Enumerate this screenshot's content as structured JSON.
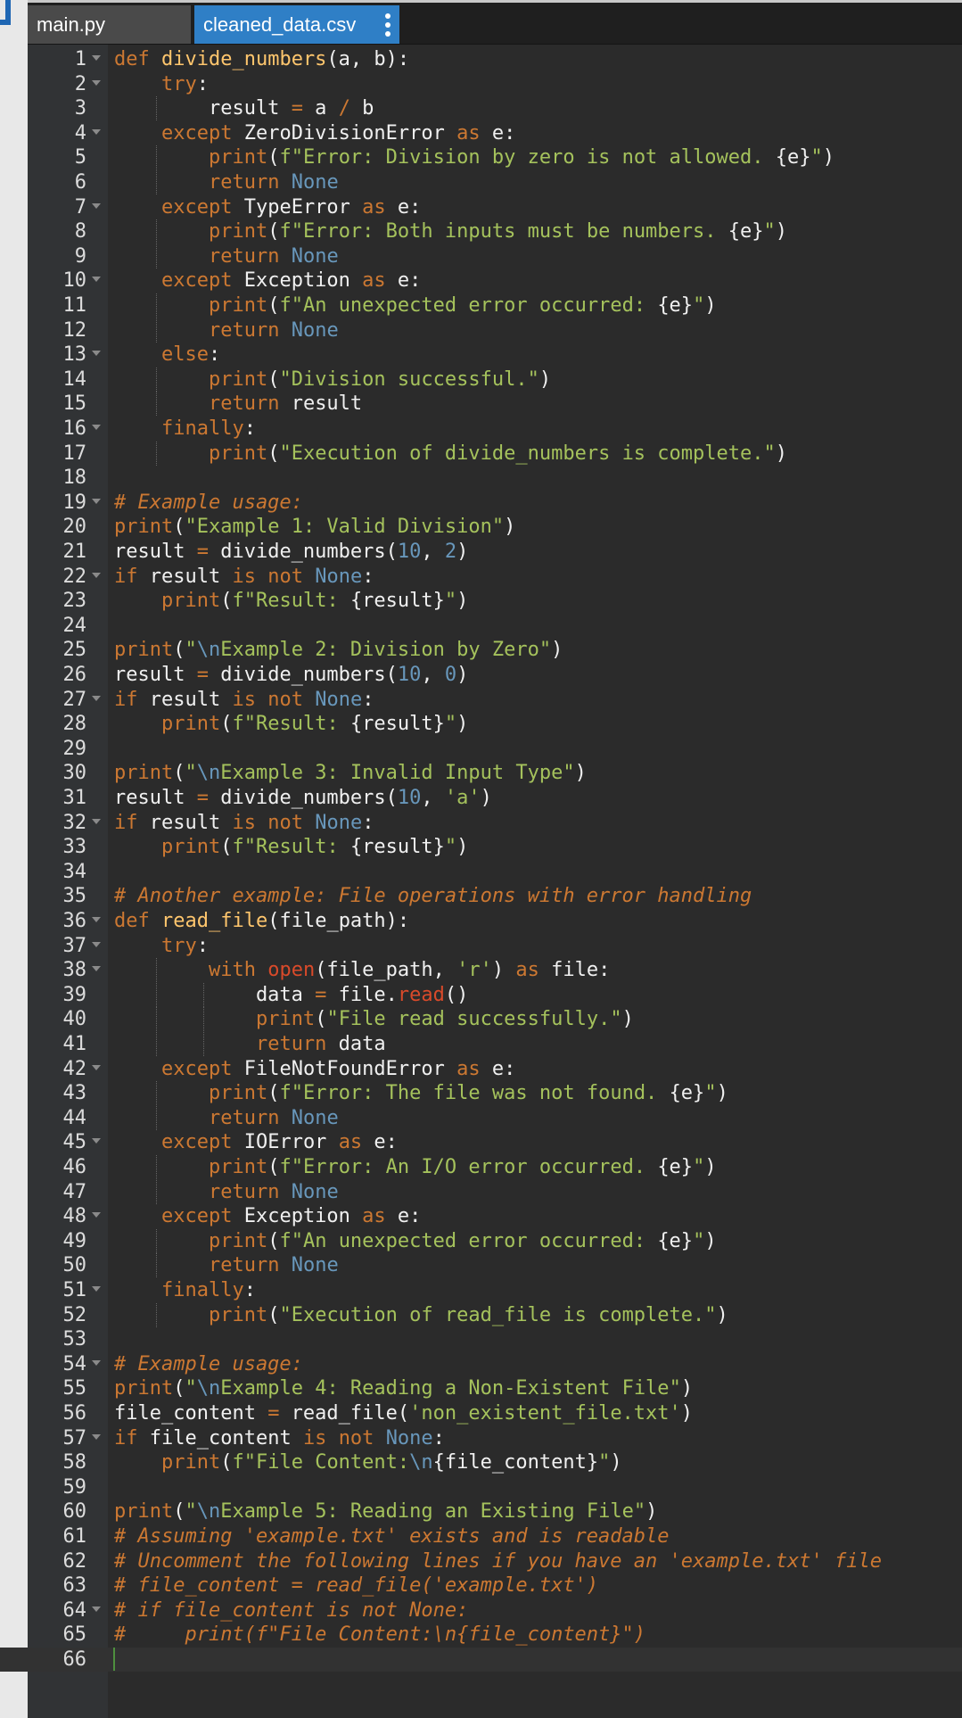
{
  "tabs": [
    {
      "label": "main.py",
      "active": false
    },
    {
      "label": "cleaned_data.csv",
      "active": true
    }
  ],
  "colors": {
    "keyword": "#cc7832",
    "function": "#ffc66d",
    "string": "#a5c25c",
    "number": "#6897bb",
    "builtin": "#d94a2a",
    "active_tab": "#2f7fc6"
  },
  "editor": {
    "language": "python",
    "cursor_line": 66,
    "lines": [
      "def divide_numbers(a, b):",
      "    try:",
      "        result = a / b",
      "    except ZeroDivisionError as e:",
      "        print(f\"Error: Division by zero is not allowed. {e}\")",
      "        return None",
      "    except TypeError as e:",
      "        print(f\"Error: Both inputs must be numbers. {e}\")",
      "        return None",
      "    except Exception as e:",
      "        print(f\"An unexpected error occurred: {e}\")",
      "        return None",
      "    else:",
      "        print(\"Division successful.\")",
      "        return result",
      "    finally:",
      "        print(\"Execution of divide_numbers is complete.\")",
      "",
      "# Example usage:",
      "print(\"Example 1: Valid Division\")",
      "result = divide_numbers(10, 2)",
      "if result is not None:",
      "    print(f\"Result: {result}\")",
      "",
      "print(\"\\nExample 2: Division by Zero\")",
      "result = divide_numbers(10, 0)",
      "if result is not None:",
      "    print(f\"Result: {result}\")",
      "",
      "print(\"\\nExample 3: Invalid Input Type\")",
      "result = divide_numbers(10, 'a')",
      "if result is not None:",
      "    print(f\"Result: {result}\")",
      "",
      "# Another example: File operations with error handling",
      "def read_file(file_path):",
      "    try:",
      "        with open(file_path, 'r') as file:",
      "            data = file.read()",
      "            print(\"File read successfully.\")",
      "            return data",
      "    except FileNotFoundError as e:",
      "        print(f\"Error: The file was not found. {e}\")",
      "        return None",
      "    except IOError as e:",
      "        print(f\"Error: An I/O error occurred. {e}\")",
      "        return None",
      "    except Exception as e:",
      "        print(f\"An unexpected error occurred: {e}\")",
      "        return None",
      "    finally:",
      "        print(\"Execution of read_file is complete.\")",
      "",
      "# Example usage:",
      "print(\"\\nExample 4: Reading a Non-Existent File\")",
      "file_content = read_file('non_existent_file.txt')",
      "if file_content is not None:",
      "    print(f\"File Content:\\n{file_content}\")",
      "",
      "print(\"\\nExample 5: Reading an Existing File\")",
      "# Assuming 'example.txt' exists and is readable",
      "# Uncomment the following lines if you have an 'example.txt' file",
      "# file_content = read_file('example.txt')",
      "# if file_content is not None:",
      "#     print(f\"File Content:\\n{file_content}\")",
      ""
    ],
    "fold_lines": [
      1,
      2,
      4,
      7,
      10,
      13,
      16,
      19,
      22,
      27,
      32,
      36,
      37,
      38,
      42,
      45,
      48,
      51,
      54,
      57,
      64
    ]
  }
}
